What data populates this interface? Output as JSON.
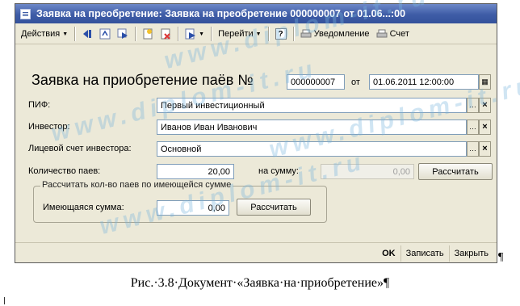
{
  "window": {
    "title": "Заявка на преобретение: Заявка на преобретение 000000007 от 01.06...:00"
  },
  "toolbar": {
    "actions_label": "Действия",
    "goto_label": "Перейти",
    "help_label": "?",
    "notify_label": "Уведомление",
    "invoice_label": "Счет",
    "icons": [
      "arrow-left-icon",
      "refresh-icon",
      "arrow-right-icon",
      "new-document-icon",
      "delete-document-icon",
      "post-document-icon",
      "help-icon",
      "printer-icon",
      "printer-icon"
    ]
  },
  "form": {
    "title": "Заявка на приобретение паёв №",
    "number": "000000007",
    "date_label": "от",
    "date": "01.06.2011 12:00:00",
    "pif_label": "ПИФ:",
    "pif_value": "Первый инвестиционный",
    "investor_label": "Инвестор:",
    "investor_value": "Иванов Иван Иванович",
    "account_label": "Лицевой счет инвестора:",
    "account_value": "Основной",
    "shares_label": "Количество паев:",
    "shares_value": "20,00",
    "sum_label": "на сумму:",
    "sum_value": "0,00",
    "calc_button": "Рассчитать",
    "group_title": "Рассчитать кол-во паев по имеющейся сумме",
    "available_label": "Имеющаяся сумма:",
    "available_value": "0,00",
    "group_calc_button": "Рассчитать"
  },
  "bottom": {
    "ok_label": "OK",
    "save_label": "Записать",
    "close_label": "Закрыть"
  },
  "caption": {
    "text": "Рис.·3.8·Документ·«Заявка·на·приобретение»¶",
    "pilcrow": "¶"
  },
  "watermark": {
    "text": "www.diplom-it.ru"
  }
}
